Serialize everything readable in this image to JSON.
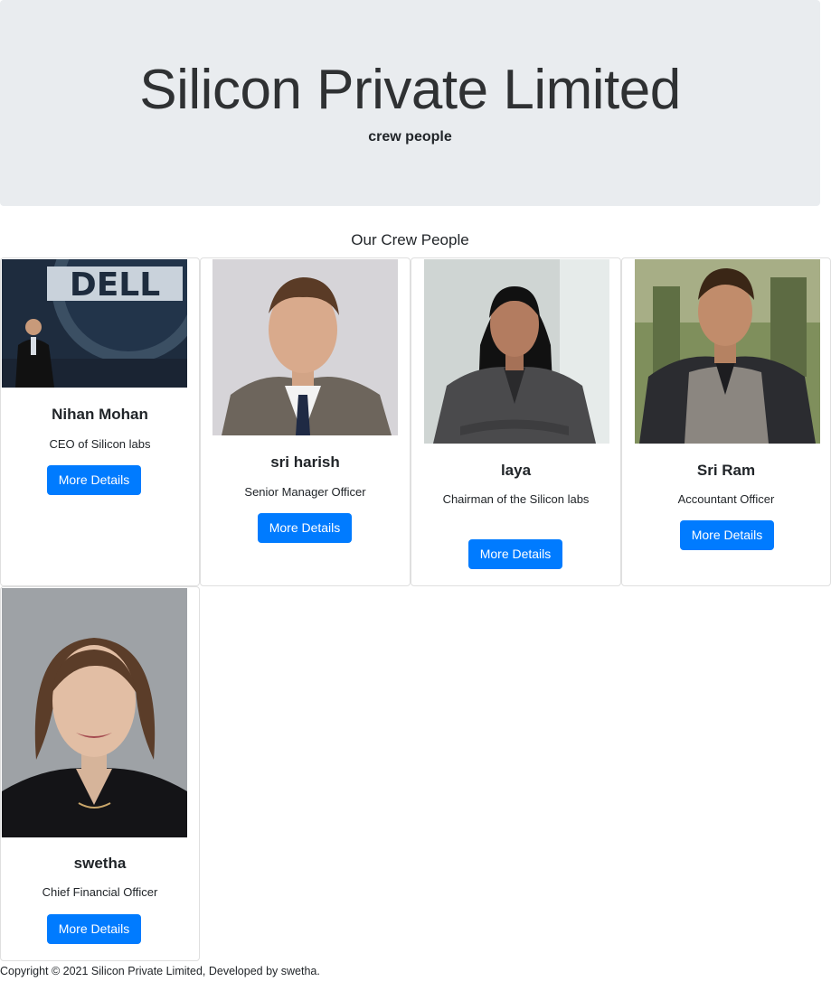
{
  "header": {
    "title": "Silicon Private Limited",
    "subtitle": "crew people"
  },
  "section_title": "Our Crew People",
  "cards": [
    {
      "name": "Nihan Mohan",
      "role": "CEO of Silicon labs",
      "button": "More Details"
    },
    {
      "name": "sri harish",
      "role": "Senior Manager Officer",
      "button": "More Details"
    },
    {
      "name": "laya",
      "role": "Chairman of the Silicon labs",
      "button": "More Details"
    },
    {
      "name": "Sri Ram",
      "role": "Accountant Officer",
      "button": "More Details"
    },
    {
      "name": "swetha",
      "role": "Chief Financial Officer",
      "button": "More Details"
    }
  ],
  "logo_text": "DELL",
  "footer": "Copyright © 2021 Silicon Private Limited, Developed by swetha.",
  "colors": {
    "jumbotron_bg": "#e9ecef",
    "button_bg": "#007bff"
  }
}
